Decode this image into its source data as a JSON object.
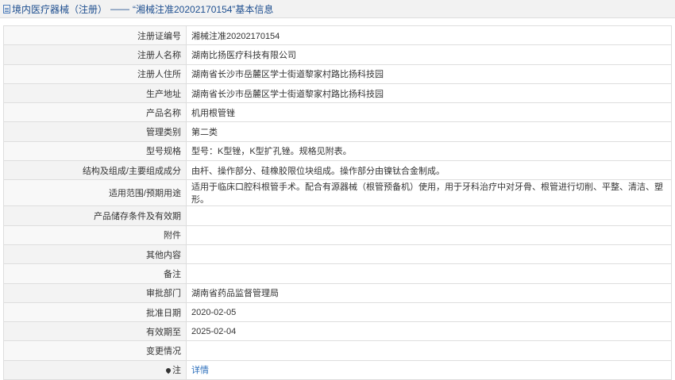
{
  "header": {
    "title_prefix": "境内医疗器械（注册）",
    "separator": "——",
    "title_suffix": "“湘械注准20202170154”基本信息"
  },
  "rows": [
    {
      "label": "注册证编号",
      "value": "湘械注准20202170154"
    },
    {
      "label": "注册人名称",
      "value": "湖南比扬医疗科技有限公司"
    },
    {
      "label": "注册人住所",
      "value": "湖南省长沙市岳麓区学士街道黎家村路比扬科技园"
    },
    {
      "label": "生产地址",
      "value": "湖南省长沙市岳麓区学士街道黎家村路比扬科技园"
    },
    {
      "label": "产品名称",
      "value": "机用根管锉"
    },
    {
      "label": "管理类别",
      "value": "第二类"
    },
    {
      "label": "型号规格",
      "value": "型号：K型锉，K型扩孔锉。规格见附表。"
    },
    {
      "label": "结构及组成/主要组成成分",
      "value": "由杆、操作部分、硅橡胶限位块组成。操作部分由镍钛合金制成。"
    },
    {
      "label": "适用范围/预期用途",
      "value": "适用于临床口腔科根管手术。配合有源器械（根管预备机）使用，用于牙科治疗中对牙骨、根管进行切削、平整、清洁、塑形。"
    },
    {
      "label": "产品储存条件及有效期",
      "value": ""
    },
    {
      "label": "附件",
      "value": ""
    },
    {
      "label": "其他内容",
      "value": ""
    },
    {
      "label": "备注",
      "value": ""
    },
    {
      "label": "审批部门",
      "value": "湖南省药品监督管理局"
    },
    {
      "label": "批准日期",
      "value": "2020-02-05"
    },
    {
      "label": "有效期至",
      "value": "2025-02-04"
    },
    {
      "label": "变更情况",
      "value": ""
    }
  ],
  "note_row": {
    "label": "注",
    "link": "详情"
  },
  "colors": {
    "title": "#1d4e8f",
    "link": "#2a6ebb",
    "border": "#dedede"
  },
  "icons": {
    "doc": "document-icon",
    "pin": "location-pin-icon"
  }
}
